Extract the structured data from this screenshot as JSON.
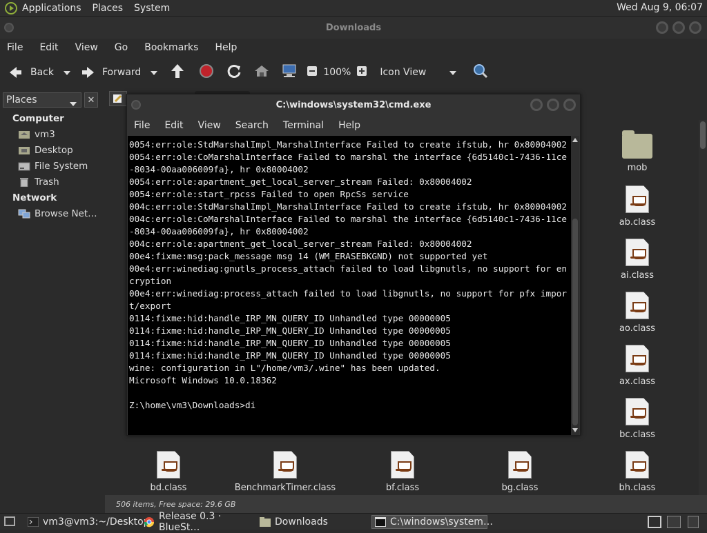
{
  "top_panel": {
    "menus": [
      "Applications",
      "Places",
      "System"
    ],
    "clock": "Wed Aug  9, 06:07"
  },
  "nautilus": {
    "title": "Downloads",
    "menubar": [
      "File",
      "Edit",
      "View",
      "Go",
      "Bookmarks",
      "Help"
    ],
    "toolbar": {
      "back": "Back",
      "forward": "Forward",
      "zoom": "100%",
      "view_mode": "Icon View"
    },
    "sidebar": {
      "header": "Places",
      "sections": [
        {
          "title": "Computer",
          "items": [
            "vm3",
            "Desktop",
            "File System",
            "Trash"
          ]
        },
        {
          "title": "Network",
          "items": [
            "Browse Net…"
          ]
        }
      ]
    },
    "files_right": [
      "mob",
      "ab.class",
      "ai.class",
      "ao.class",
      "ax.class",
      "bc.class",
      "bh.class"
    ],
    "files_bottom": [
      "bd.class",
      "BenchmarkTimer.class",
      "bf.class",
      "bg.class"
    ],
    "status": "506 items, Free space: 29.6 GB"
  },
  "cmd": {
    "title": "C:\\windows\\system32\\cmd.exe",
    "menubar": [
      "File",
      "Edit",
      "View",
      "Search",
      "Terminal",
      "Help"
    ],
    "lines": [
      "0054:err:ole:StdMarshalImpl_MarshalInterface Failed to create ifstub, hr 0x80004002",
      "0054:err:ole:CoMarshalInterface Failed to marshal the interface {6d5140c1-7436-11ce-8034-00aa006009fa}, hr 0x80004002",
      "0054:err:ole:apartment_get_local_server_stream Failed: 0x80004002",
      "0054:err:ole:start_rpcss Failed to open RpcSs service",
      "004c:err:ole:StdMarshalImpl_MarshalInterface Failed to create ifstub, hr 0x80004002",
      "004c:err:ole:CoMarshalInterface Failed to marshal the interface {6d5140c1-7436-11ce-8034-00aa006009fa}, hr 0x80004002",
      "004c:err:ole:apartment_get_local_server_stream Failed: 0x80004002",
      "00e4:fixme:msg:pack_message msg 14 (WM_ERASEBKGND) not supported yet",
      "00e4:err:winediag:gnutls_process_attach failed to load libgnutls, no support for encryption",
      "00e4:err:winediag:process_attach failed to load libgnutls, no support for pfx import/export",
      "0114:fixme:hid:handle_IRP_MN_QUERY_ID Unhandled type 00000005",
      "0114:fixme:hid:handle_IRP_MN_QUERY_ID Unhandled type 00000005",
      "0114:fixme:hid:handle_IRP_MN_QUERY_ID Unhandled type 00000005",
      "0114:fixme:hid:handle_IRP_MN_QUERY_ID Unhandled type 00000005",
      "wine: configuration in L\"/home/vm3/.wine\" has been updated.",
      "Microsoft Windows 10.0.18362",
      "",
      "Z:\\home\\vm3\\Downloads>di"
    ]
  },
  "taskbar": {
    "tasks": [
      "vm3@vm3:~/Desktop",
      "Release 0.3 · BlueSt…",
      "Downloads",
      "C:\\windows\\system…"
    ]
  }
}
